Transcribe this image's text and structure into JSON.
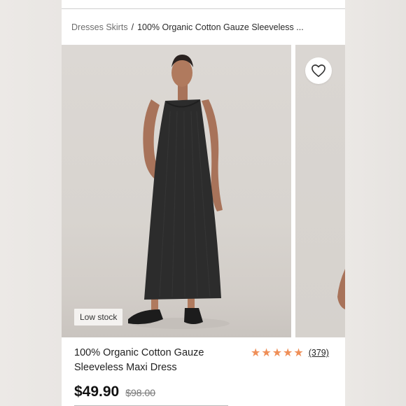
{
  "breadcrumb": {
    "category": "Dresses Skirts",
    "separator": "/",
    "current": "100% Organic Cotton Gauze Sleeveless ..."
  },
  "gallery": {
    "badge": "Low stock",
    "favorite_icon": "heart-icon"
  },
  "product": {
    "title": "100% Organic Cotton Gauze Sleeveless Maxi Dress",
    "rating_stars": 5,
    "review_count": "(379)",
    "price_current": "$49.90",
    "price_original": "$98.00"
  },
  "colors": {
    "star": "#ef8f58",
    "text": "#222222",
    "muted": "#777777"
  }
}
